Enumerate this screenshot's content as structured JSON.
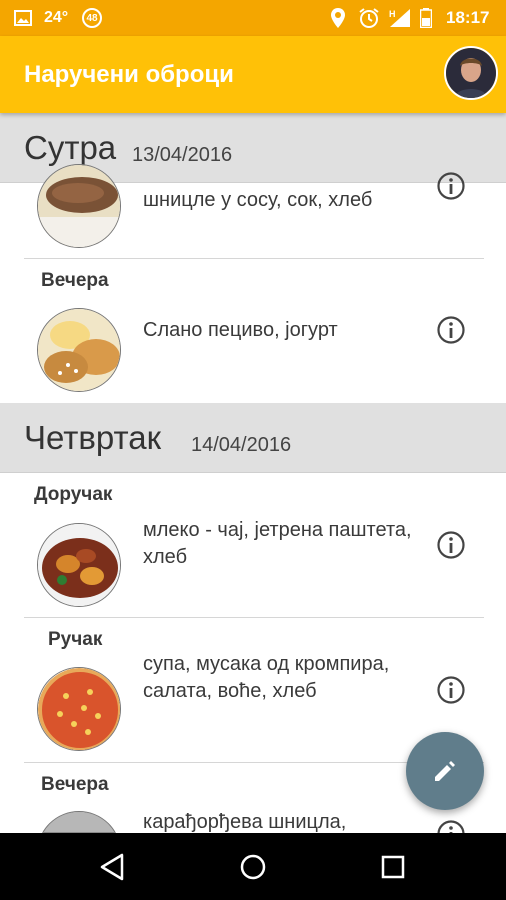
{
  "status_bar": {
    "temperature": "24°",
    "badge": "48",
    "network": "H",
    "time": "18:17"
  },
  "app_bar": {
    "title": "Наручени оброци"
  },
  "days": [
    {
      "name": "Сутра",
      "date": "13/04/2016",
      "meals": [
        {
          "label": "",
          "description": "шницле у сосу, сок, хлеб"
        },
        {
          "label": "Вечера",
          "description": "Слано пециво, јогурт"
        }
      ]
    },
    {
      "name": "Четвртак",
      "date": "14/04/2016",
      "meals": [
        {
          "label": "Доручак",
          "description": "млеко - чај, јетрена паштета, хлеб"
        },
        {
          "label": "Ручак",
          "description": "супа, мусака од кромпира, салата, воће, хлеб"
        },
        {
          "label": "Вечера",
          "description": "карађорђева шницла,"
        }
      ]
    }
  ],
  "colors": {
    "status_bar": "#F4A600",
    "app_bar": "#FFC107",
    "fab": "#607D8B",
    "day_header": "#E0E0E0"
  },
  "icons": {
    "info": "info-icon",
    "fab": "pencil-icon",
    "nav": [
      "back-icon",
      "home-icon",
      "recents-icon"
    ]
  }
}
